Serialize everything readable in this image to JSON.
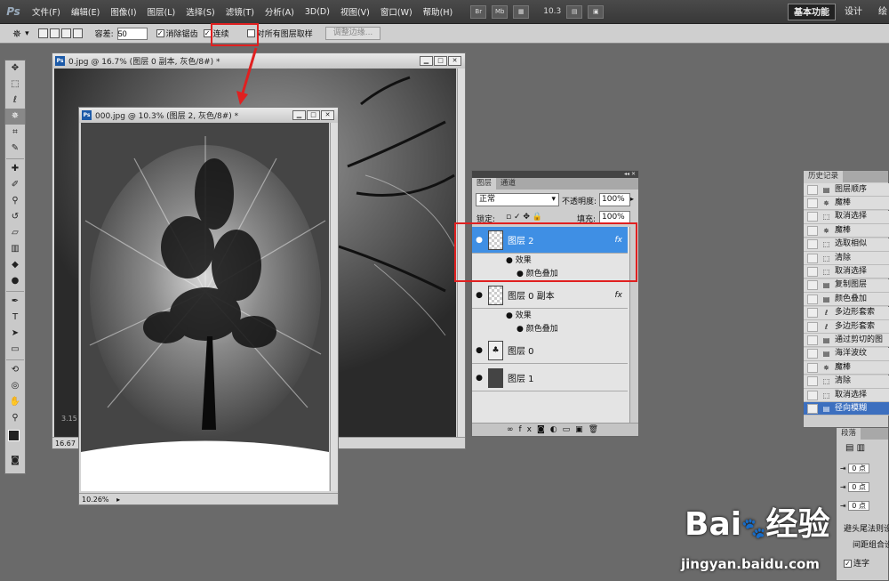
{
  "menubar": {
    "logo": "Ps",
    "items": [
      "文件(F)",
      "编辑(E)",
      "图像(I)",
      "图层(L)",
      "选择(S)",
      "滤镜(T)",
      "分析(A)",
      "3D(D)",
      "视图(V)",
      "窗口(W)",
      "帮助(H)"
    ],
    "quick_buttons": [
      "Br",
      "Mb"
    ],
    "zoom": "10.3",
    "workspaces": {
      "active": "基本功能",
      "second": "设计",
      "third": "绘"
    }
  },
  "options": {
    "tolerance_label": "容差:",
    "tolerance_value": "50",
    "antialias_label": "消除锯齿",
    "contiguous_label": "连续",
    "sample_prefix": "对",
    "sample_all_label": "所有图层取样",
    "refine_edge": "调整边缘..."
  },
  "doc_back": {
    "title": "0.jpg @ 16.7% (图层 0 副本, 灰色/8#) *",
    "status": "16.67",
    "mark": "3.15"
  },
  "doc_front": {
    "title": "000.jpg @ 10.3% (图层 2, 灰色/8#) *",
    "status": "10.26%"
  },
  "layers_panel": {
    "tabs": [
      "图层",
      "通道"
    ],
    "blend_mode": "正常",
    "opacity_label": "不透明度:",
    "opacity_value": "100%",
    "lock_label": "锁定:",
    "fill_label": "填充:",
    "fill_value": "100%",
    "layers": [
      {
        "name": "图层 2",
        "fx": "fx",
        "effects_label": "效果",
        "effect": "颜色叠加"
      },
      {
        "name": "图层 0 副本",
        "fx": "fx",
        "effects_label": "效果",
        "effect": "颜色叠加"
      },
      {
        "name": "图层 0"
      },
      {
        "name": "图层 1"
      }
    ]
  },
  "history_panel": {
    "title": "历史记录",
    "items": [
      "图层顺序",
      "魔棒",
      "取消选择",
      "魔棒",
      "选取相似",
      "清除",
      "取消选择",
      "复制图层",
      "颜色叠加",
      "多边形套索",
      "多边形套索",
      "通过剪切的图",
      "海洋波纹",
      "魔棒",
      "清除",
      "取消选择",
      "径向模糊"
    ]
  },
  "paragraph_panel": {
    "title": "段落",
    "indent_values": [
      "0 点",
      "0 点",
      "0 点"
    ],
    "text1": "避头尾法则设",
    "text2": "间距组合设",
    "hyphen_label": "连字"
  },
  "watermark": {
    "brand": "Bai",
    "brand2": "经验",
    "url": "jingyan.baidu.com"
  },
  "colors": {
    "accent": "#3f8fe4",
    "highlight": "#e02020"
  }
}
